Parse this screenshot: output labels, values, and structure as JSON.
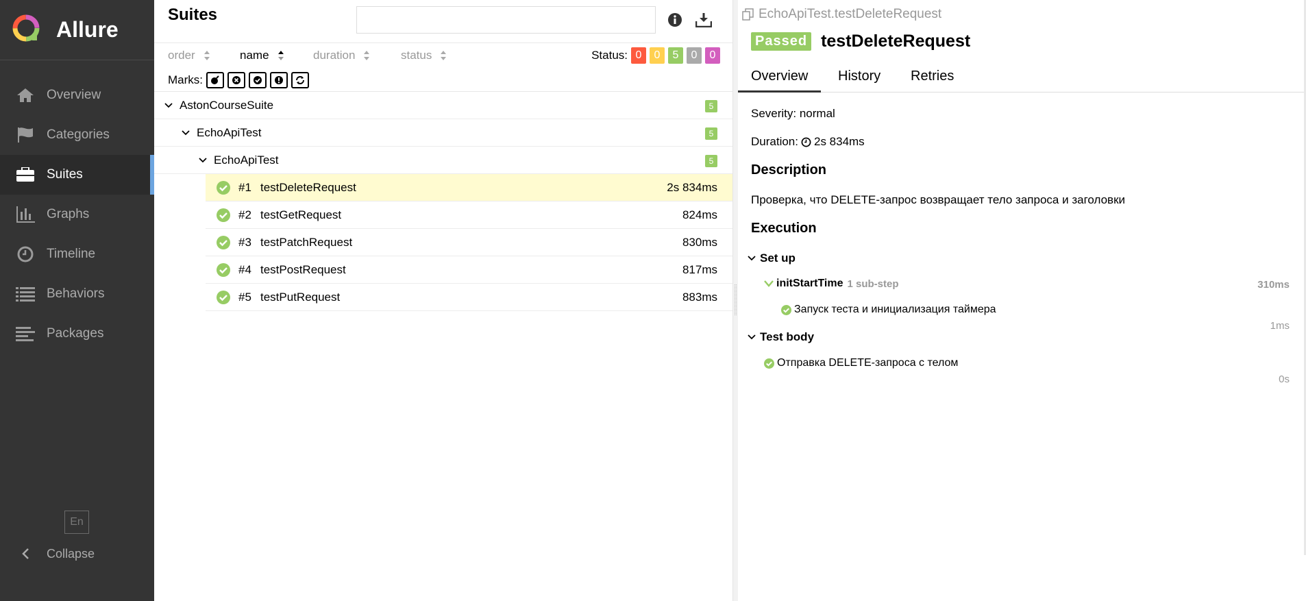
{
  "sidebar": {
    "brand": "Allure",
    "items": [
      {
        "label": "Overview",
        "icon": "home-icon"
      },
      {
        "label": "Categories",
        "icon": "flag-icon"
      },
      {
        "label": "Suites",
        "icon": "briefcase-icon",
        "active": true
      },
      {
        "label": "Graphs",
        "icon": "bar-chart-icon"
      },
      {
        "label": "Timeline",
        "icon": "clock-icon"
      },
      {
        "label": "Behaviors",
        "icon": "list-icon"
      },
      {
        "label": "Packages",
        "icon": "align-left-icon"
      }
    ],
    "lang": "En",
    "collapse": "Collapse"
  },
  "suites": {
    "title": "Suites",
    "search_value": "",
    "sort": {
      "order": "order",
      "name": "name",
      "duration": "duration",
      "status": "status"
    },
    "status_label": "Status:",
    "status_counts": [
      {
        "value": "0",
        "color": "#fd5a3e"
      },
      {
        "value": "0",
        "color": "#ffd050"
      },
      {
        "value": "5",
        "color": "#97cc64"
      },
      {
        "value": "0",
        "color": "#aaaaaa"
      },
      {
        "value": "0",
        "color": "#d35ebe"
      }
    ],
    "marks_label": "Marks:",
    "tree": [
      {
        "name": "AstonCourseSuite",
        "count": "5"
      },
      {
        "name": "EchoApiTest",
        "count": "5"
      },
      {
        "name": "EchoApiTest",
        "count": "5"
      }
    ],
    "tests": [
      {
        "num": "#1",
        "name": "testDeleteRequest",
        "duration": "2s 834ms",
        "selected": true
      },
      {
        "num": "#2",
        "name": "testGetRequest",
        "duration": "824ms"
      },
      {
        "num": "#3",
        "name": "testPatchRequest",
        "duration": "830ms"
      },
      {
        "num": "#4",
        "name": "testPostRequest",
        "duration": "817ms"
      },
      {
        "num": "#5",
        "name": "testPutRequest",
        "duration": "883ms"
      }
    ]
  },
  "detail": {
    "path": "EchoApiTest.testDeleteRequest",
    "status": "Passed",
    "name": "testDeleteRequest",
    "tabs": [
      "Overview",
      "History",
      "Retries"
    ],
    "severity": "Severity: normal",
    "duration_label": "Duration:",
    "duration_value": "2s 834ms",
    "description_heading": "Description",
    "description": "Проверка, что DELETE-запрос возвращает тело запроса и заголовки",
    "execution_heading": "Execution",
    "setup_label": "Set up",
    "setup_step": "initStartTime",
    "setup_substeps": "1 sub-step",
    "setup_time": "310ms",
    "setup_sub": "Запуск теста и инициализация таймера",
    "setup_sub_time": "1ms",
    "body_label": "Test body",
    "body_step": "Отправка DELETE-запроса с телом",
    "body_time": "0s"
  }
}
